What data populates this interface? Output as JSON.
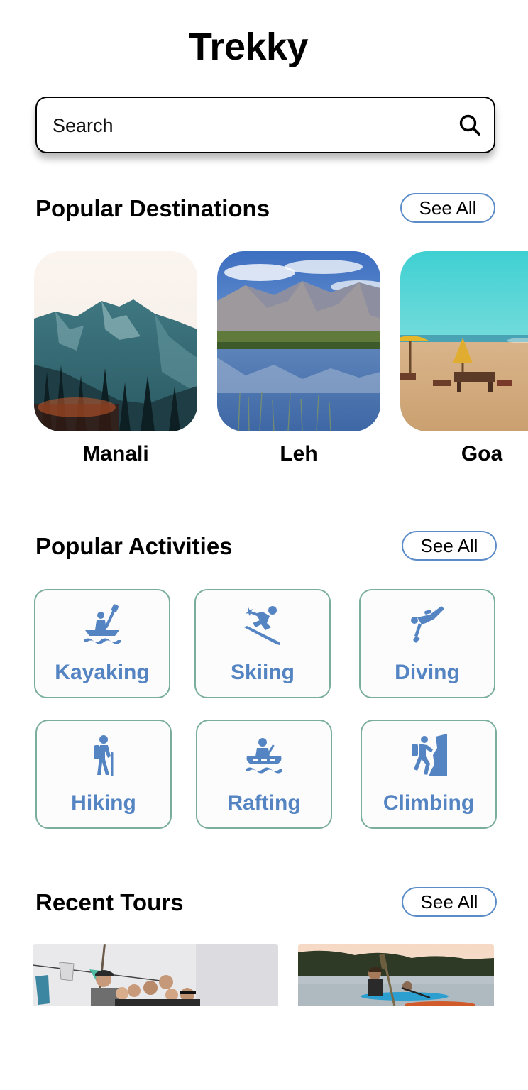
{
  "app": {
    "title": "Trekky"
  },
  "search": {
    "placeholder": "Search"
  },
  "sections": {
    "destinations": {
      "title": "Popular Destinations",
      "see_all": "See All"
    },
    "activities": {
      "title": "Popular Activities",
      "see_all": "See All"
    },
    "tours": {
      "title": "Recent Tours",
      "see_all": "See All"
    }
  },
  "destinations": [
    {
      "name": "Manali",
      "image": "mountain-forest-photo"
    },
    {
      "name": "Leh",
      "image": "mountain-lake-reflection-photo"
    },
    {
      "name": "Goa",
      "image": "beach-umbrella-photo"
    }
  ],
  "activities": [
    {
      "label": "Kayaking",
      "icon": "kayaking-icon"
    },
    {
      "label": "Skiing",
      "icon": "skiing-icon"
    },
    {
      "label": "Diving",
      "icon": "diving-icon"
    },
    {
      "label": "Hiking",
      "icon": "hiking-icon"
    },
    {
      "label": "Rafting",
      "icon": "rafting-icon"
    },
    {
      "label": "Climbing",
      "icon": "climbing-icon"
    }
  ],
  "tours": [
    {
      "image": "group-selfie-photo"
    },
    {
      "image": "kayaking-lake-photo"
    }
  ],
  "colors": {
    "accent": "#5484c2",
    "tile_border": "#7aae9a",
    "button_border": "#5b8cc8"
  }
}
